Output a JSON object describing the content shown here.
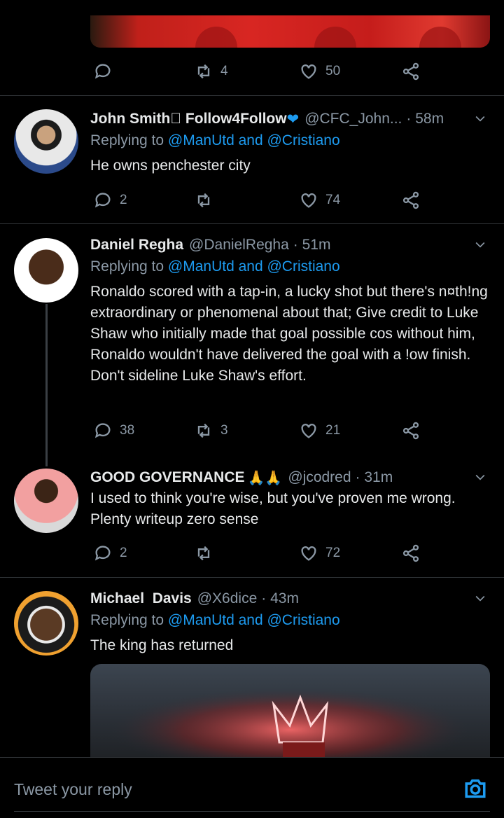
{
  "top_actions": {
    "reply_count": "",
    "retweet_count": "4",
    "like_count": "50"
  },
  "tweets": [
    {
      "name": "John Smith\u0000 Follow4Follow",
      "heart": "❤",
      "handle": "@CFC_John...",
      "time": "· 58m",
      "replying_prefix": "Replying to ",
      "mention1": "@ManUtd",
      "and": " and ",
      "mention2": "@Cristiano",
      "text": "He owns penchester city",
      "reply_count": "2",
      "retweet_count": "",
      "like_count": "74"
    },
    {
      "name": "Daniel Regha",
      "handle": "@DanielRegha",
      "time": "· 51m",
      "replying_prefix": "Replying to ",
      "mention1": "@ManUtd",
      "and": " and ",
      "mention2": "@Cristiano",
      "text": "Ronaldo scored with a tap-in, a lucky shot but there's n¤th!ng extraordinary or phenomenal about that; Give credit to Luke Shaw who initially made that goal possible cos without him, Ronaldo wouldn't have delivered the goal with a !ow finish. Don't sideline Luke Shaw's effort.",
      "reply_count": "38",
      "retweet_count": "3",
      "like_count": "21"
    },
    {
      "name": "GOOD GOVERNANCE",
      "emoji": "🙏🙏",
      "handle": "@jcodred",
      "time": "· 31m",
      "text": "I used to think you're wise, but you've proven me wrong. Plenty writeup zero sense",
      "reply_count": "2",
      "retweet_count": "",
      "like_count": "72"
    },
    {
      "name": "Michael  Davis",
      "handle": "@X6dice",
      "time": "· 43m",
      "replying_prefix": "Replying to ",
      "mention1": "@ManUtd",
      "and": " and ",
      "mention2": "@Cristiano",
      "text": "The king has returned"
    }
  ],
  "reply_bar": {
    "placeholder": "Tweet your reply"
  },
  "colors": {
    "accent": "#1d9bf0",
    "muted": "#8b98a5",
    "background": "#000000"
  },
  "icons": [
    "reply-icon",
    "retweet-icon",
    "like-icon",
    "share-icon",
    "chevron-down-icon",
    "camera-icon"
  ]
}
